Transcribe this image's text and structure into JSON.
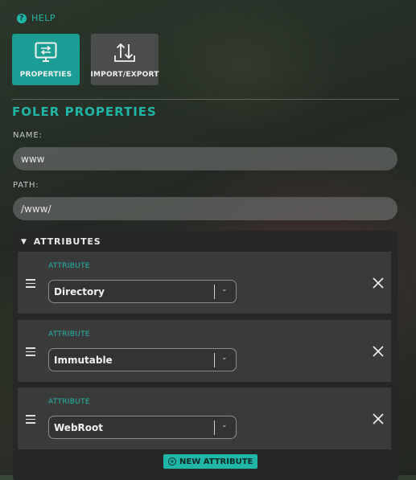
{
  "help": {
    "label": "HELP",
    "icon": "help-circle-icon"
  },
  "tabs": [
    {
      "label": "PROPERTIES",
      "icon": "properties-monitor-icon",
      "active": true
    },
    {
      "label": "IMPORT/EXPORT",
      "icon": "import-export-icon",
      "active": false
    }
  ],
  "section_title": "FOLER PROPERTIES",
  "fields": {
    "name": {
      "label": "NAME:",
      "value": "www"
    },
    "path": {
      "label": "PATH:",
      "value": "/www/"
    }
  },
  "attributes": {
    "header": "ATTRIBUTES",
    "items": [
      {
        "label": "ATTRIBUTE",
        "value": "Directory"
      },
      {
        "label": "ATTRIBUTE",
        "value": "Immutable"
      },
      {
        "label": "ATTRIBUTE",
        "value": "WebRoot"
      }
    ],
    "new_button": "NEW ATTRIBUTE"
  },
  "colors": {
    "accent": "#1fb6a8",
    "panel": "#262727",
    "card": "#3a3b3b"
  }
}
